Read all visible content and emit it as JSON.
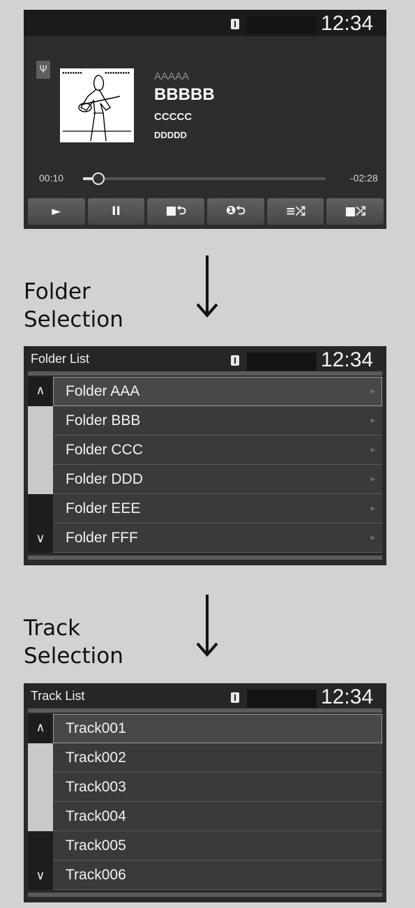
{
  "player": {
    "clock": "12:34",
    "usb_icon": "usb-icon",
    "artist": "AAAAA",
    "title": "BBBBB",
    "album": "CCCCC",
    "genre": "DDDDD",
    "elapsed": "00:10",
    "remaining": "-02:28",
    "progress_fraction": 0.06,
    "controls": [
      {
        "icon": "play-icon",
        "label": "►"
      },
      {
        "icon": "pause-icon",
        "label": "II"
      },
      {
        "icon": "folder-repeat-icon",
        "label": "■⮌"
      },
      {
        "icon": "track-repeat-icon",
        "label": "❶⮌"
      },
      {
        "icon": "shuffle-icon",
        "label": "≡⤮"
      },
      {
        "icon": "folder-shuffle-icon",
        "label": "■⤮"
      }
    ]
  },
  "steps": {
    "folder": [
      "Folder",
      "Selection"
    ],
    "track": [
      "Track",
      "Selection"
    ]
  },
  "folder_list": {
    "title": "Folder List",
    "clock": "12:34",
    "items": [
      "Folder AAA",
      "Folder BBB",
      "Folder CCC",
      "Folder DDD",
      "Folder EEE",
      "Folder FFF"
    ],
    "chevron": "▸"
  },
  "track_list": {
    "title": "Track List",
    "clock": "12:34",
    "items": [
      "Track001",
      "Track002",
      "Track003",
      "Track004",
      "Track005",
      "Track006"
    ]
  },
  "colors": {
    "page_bg": "#d1d2d4",
    "screen_bg": "#2a2a2a",
    "row_bg": "#3a3a3a",
    "selected_row_bg": "#484848",
    "text": "#f2f2f2"
  }
}
